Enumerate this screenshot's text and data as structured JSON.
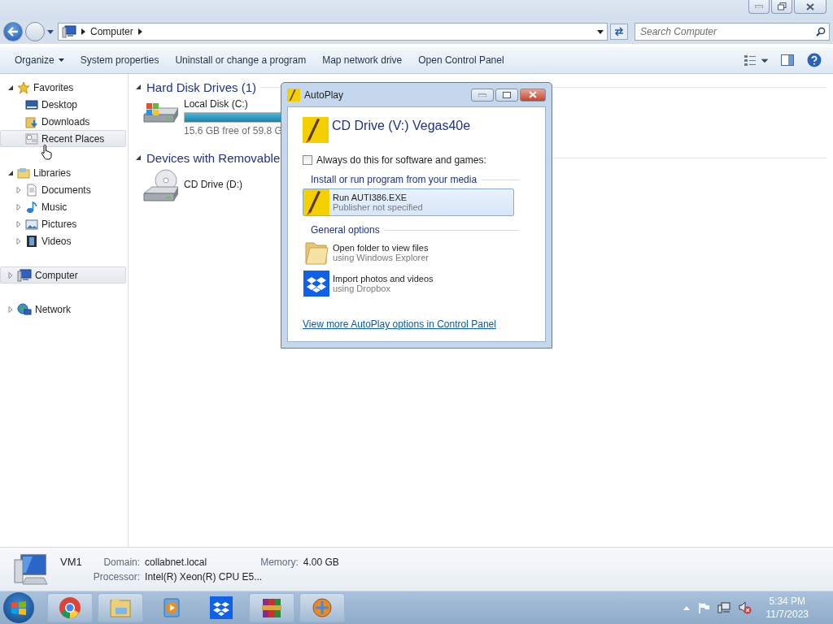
{
  "window": {
    "address": {
      "crumbs": [
        "Computer"
      ]
    },
    "search": {
      "placeholder": "Search Computer"
    }
  },
  "toolbar": {
    "items": [
      {
        "label": "Organize",
        "kind": "menu"
      },
      {
        "label": "System properties",
        "kind": "plain"
      },
      {
        "label": "Uninstall or change a program",
        "kind": "plain"
      },
      {
        "label": "Map network drive",
        "kind": "plain"
      },
      {
        "label": "Open Control Panel",
        "kind": "plain"
      }
    ]
  },
  "nav": {
    "groups": [
      {
        "label": "Favorites",
        "kind": "star",
        "expanded": true,
        "selected": false,
        "children": [
          {
            "label": "Desktop",
            "kind": "desktop",
            "selected": false
          },
          {
            "label": "Downloads",
            "kind": "downloads",
            "selected": false
          },
          {
            "label": "Recent Places",
            "kind": "recent",
            "selected": true
          }
        ]
      },
      {
        "label": "Libraries",
        "kind": "library",
        "expanded": true,
        "selected": false,
        "children": [
          {
            "label": "Documents",
            "kind": "documents",
            "expanded": false,
            "selected": false
          },
          {
            "label": "Music",
            "kind": "music",
            "expanded": false,
            "selected": false
          },
          {
            "label": "Pictures",
            "kind": "pictures",
            "expanded": false,
            "selected": false
          },
          {
            "label": "Videos",
            "kind": "videos",
            "expanded": false,
            "selected": false
          }
        ]
      },
      {
        "label": "Computer",
        "kind": "computer",
        "expanded": false,
        "selected": true
      },
      {
        "label": "Network",
        "kind": "network",
        "expanded": false,
        "selected": false
      }
    ]
  },
  "content": {
    "sections": [
      {
        "title": "Hard Disk Drives (1)",
        "expanded": true,
        "items": [
          {
            "name": "Local Disk (C:)",
            "kind": "disk",
            "level": 0.74,
            "info": "15.6 GB free of 59.8 G"
          }
        ]
      },
      {
        "title": "Devices with Removable",
        "expanded": true,
        "items": [
          {
            "name": "CD Drive (D:)",
            "kind": "cd"
          }
        ]
      }
    ]
  },
  "details": {
    "name": "VM1",
    "fields": [
      {
        "label": "Domain:",
        "value": "collabnet.local"
      },
      {
        "label": "Memory:",
        "value": "4.00 GB"
      },
      {
        "label": "Processor:",
        "value": "Intel(R) Xeon(R) CPU E5..."
      }
    ]
  },
  "dialog": {
    "title": "AutoPlay",
    "heading": "CD Drive (V:) Vegas40e",
    "always": {
      "label": "Always do this for software and games:",
      "checked": false
    },
    "groups": [
      {
        "title": "Install or run program from your media",
        "options": [
          {
            "title": "Run AUTI386.EXE",
            "subtitle": "Publisher not specified",
            "kind": "program",
            "selected": true
          }
        ]
      },
      {
        "title": "General options",
        "options": [
          {
            "title": "Open folder to view files",
            "subtitle": "using Windows Explorer",
            "kind": "folder",
            "selected": false
          },
          {
            "title": "Import photos and videos",
            "subtitle": "using Dropbox",
            "kind": "dropbox",
            "selected": false
          }
        ]
      }
    ],
    "link": "View more AutoPlay options in Control Panel"
  },
  "taskbar": {
    "apps": [
      {
        "kind": "chrome"
      },
      {
        "kind": "explorer"
      },
      {
        "kind": "media"
      },
      {
        "kind": "dropbox"
      },
      {
        "kind": "winrar"
      },
      {
        "kind": "app"
      }
    ],
    "time": "5:34 PM",
    "date": "11/7/2023"
  }
}
